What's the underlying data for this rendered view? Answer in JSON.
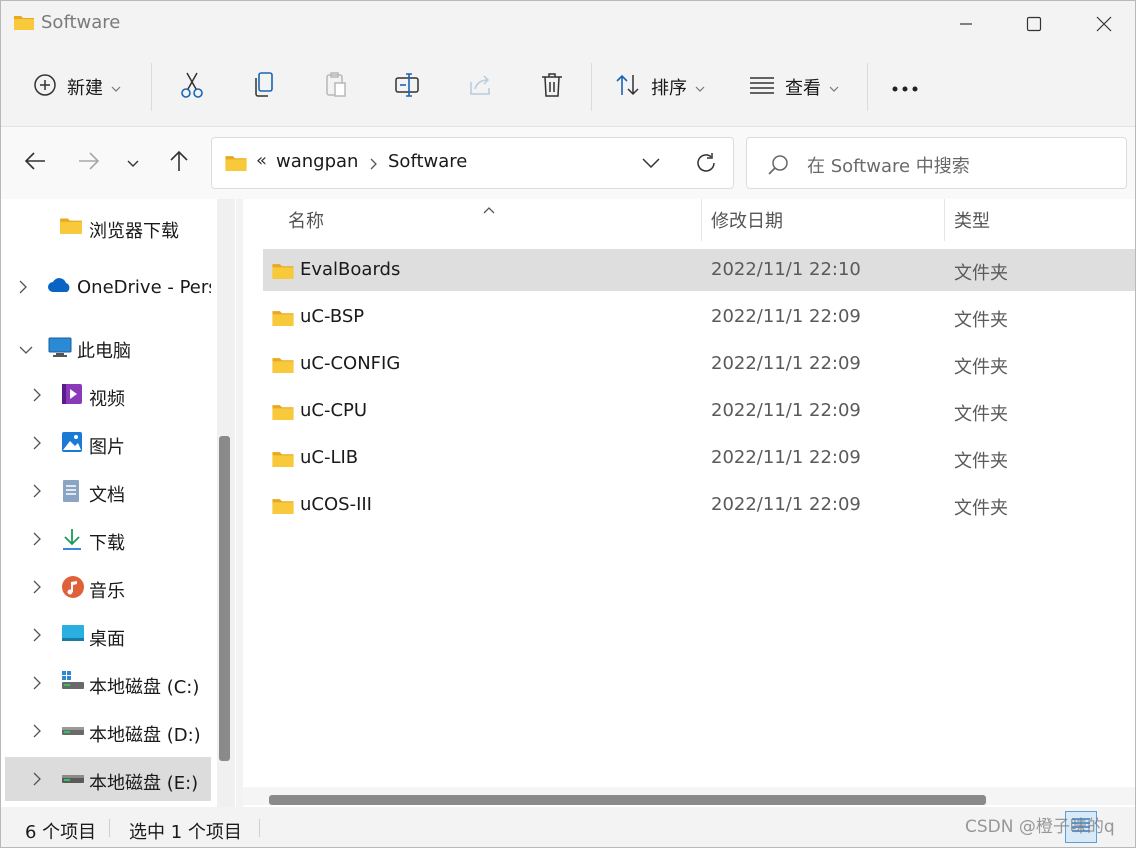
{
  "window": {
    "title": "Software"
  },
  "commandbar": {
    "new_label": "新建",
    "sort_label": "排序",
    "view_label": "查看"
  },
  "address": {
    "overflow": "«",
    "crumbs": [
      "wangpan",
      "Software"
    ]
  },
  "search": {
    "placeholder": "在 Software 中搜索"
  },
  "nav": {
    "items": [
      {
        "label": "浏览器下载",
        "icon": "folder-icon"
      },
      {
        "label": "OneDrive - Pers",
        "icon": "onedrive-cloud-icon"
      },
      {
        "label": "此电脑",
        "icon": "this-pc-icon"
      },
      {
        "label": "视频",
        "icon": "videos-icon"
      },
      {
        "label": "图片",
        "icon": "pictures-icon"
      },
      {
        "label": "文档",
        "icon": "documents-icon"
      },
      {
        "label": "下载",
        "icon": "downloads-icon"
      },
      {
        "label": "音乐",
        "icon": "music-icon"
      },
      {
        "label": "桌面",
        "icon": "desktop-icon"
      },
      {
        "label": "本地磁盘 (C:)",
        "icon": "system-drive-icon"
      },
      {
        "label": "本地磁盘 (D:)",
        "icon": "drive-icon"
      },
      {
        "label": "本地磁盘 (E:)",
        "icon": "drive-icon"
      }
    ],
    "selected_index": 11
  },
  "filelist": {
    "columns": {
      "name": "名称",
      "modified": "修改日期",
      "type": "类型"
    },
    "rows": [
      {
        "name": "EvalBoards",
        "modified": "2022/11/1 22:10",
        "type": "文件夹"
      },
      {
        "name": "uC-BSP",
        "modified": "2022/11/1 22:09",
        "type": "文件夹"
      },
      {
        "name": "uC-CONFIG",
        "modified": "2022/11/1 22:09",
        "type": "文件夹"
      },
      {
        "name": "uC-CPU",
        "modified": "2022/11/1 22:09",
        "type": "文件夹"
      },
      {
        "name": "uC-LIB",
        "modified": "2022/11/1 22:09",
        "type": "文件夹"
      },
      {
        "name": "uCOS-III",
        "modified": "2022/11/1 22:09",
        "type": "文件夹"
      }
    ],
    "selected_index": 0
  },
  "status": {
    "count": "6 个项目",
    "selection": "选中 1 个项目"
  },
  "watermark": "CSDN @橙子味的q",
  "colors": {
    "folder": "#f8c93a",
    "accent": "#0a64c4",
    "selection": "#dcdcdc"
  }
}
